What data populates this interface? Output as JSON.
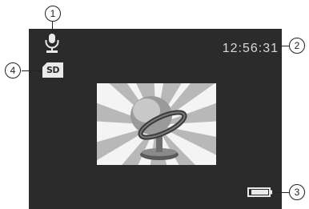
{
  "status_bar": {
    "mode_icon": "microphone-icon",
    "storage_icon": "sd-card-icon",
    "storage_label": "SD",
    "time": "12:56:31",
    "battery_icon": "battery-icon"
  },
  "preview": {
    "illustration": "microphone-record-mode-icon"
  },
  "callouts": {
    "mode": "1",
    "time": "2",
    "battery": "3",
    "storage": "4"
  },
  "colors": {
    "screen_background": "#2b2b2b",
    "text": "#d8d8d8",
    "icon": "#eaeaea"
  }
}
